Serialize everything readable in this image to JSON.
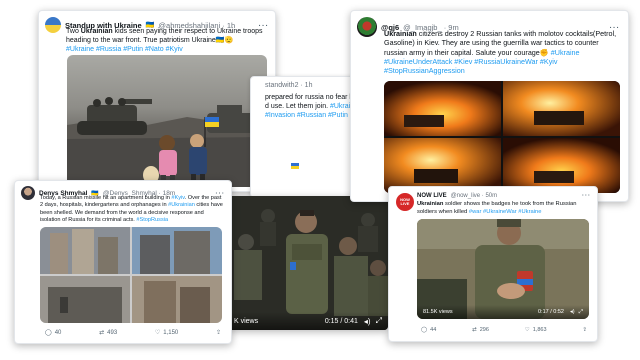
{
  "tweet_standup": {
    "author": "Standup with Ukraine",
    "flag": "🇺🇦",
    "handle_time": "@ahmedshahjilani · 1h",
    "text_lead": "Two ",
    "text_bold": "Ukrainian",
    "text_rest": " kids seen paying their respect to Ukraine troops heading to the war front. True patriotism Ukraine🇺🇦🫡",
    "hashtags": "#Ukraine #Russia #Putin #Nato #Kyiv"
  },
  "tweet_middle": {
    "handle_time": "standwith2 · 1h",
    "line1": "prepared for russia no fear l",
    "line2": "d use. Let them join. ",
    "line2_tag": "#Ukrai",
    "line3": "#Invasion #Russian #Putin"
  },
  "tweet_qj6": {
    "author": "@qj6",
    "handle_time": "@_Imagjb_ · 9m",
    "text_bold": "Ukrainian",
    "text_rest": " citizens destroy 2 Russian tanks with molotov cocktails(Petrol, Gasoline) in Kiev. They are using the guerrilla war tactics to counter russian army in their capital. Salute your courage✊ ",
    "tag_inline": "#Ukraine",
    "hashtags": "#UkraineUnderAttack #Kiev #RussiaUkraineWar #Kyiv #StopRussianAggression"
  },
  "tweet_denys": {
    "author": "Denys Shmyhal",
    "flag": "🇺🇦",
    "handle_time": "@Denys_Shmyhal · 18m",
    "text1": "Today, a Russian missile hit an apartment building in ",
    "tag_kyiv": "#Kyiv",
    "text2": ". Over the past 2 days, hospitals, kindergartens and orphanages in ",
    "tag_ukr": "#Ukrainian",
    "text3": " cities have been shelled. We demand from the world a decisive response and isolation of Russia for its criminal acts. ",
    "tag_stop": "#StopRussia",
    "replies": "40",
    "retweets": "493",
    "likes": "1,150"
  },
  "tweet_video": {
    "views": "K views",
    "time": "0:15 / 0:41"
  },
  "tweet_nowlive": {
    "author": "NOW LIVE",
    "handle_time": "@now_live · 50m",
    "logo_text": "NOW LIVE",
    "text_bold": "Ukrainian",
    "text_rest": " soldier shows the badges he took from the Russian soldiers when killed ",
    "hashtags": "#war #UkraineWar #Ukraine",
    "views": "81.5K views",
    "time": "0:17 / 0:52",
    "replies": "44",
    "retweets": "296",
    "likes": "1,863"
  },
  "colors": {
    "accent": "#1d9bf0",
    "text": "#0f1419",
    "muted": "#536471"
  }
}
